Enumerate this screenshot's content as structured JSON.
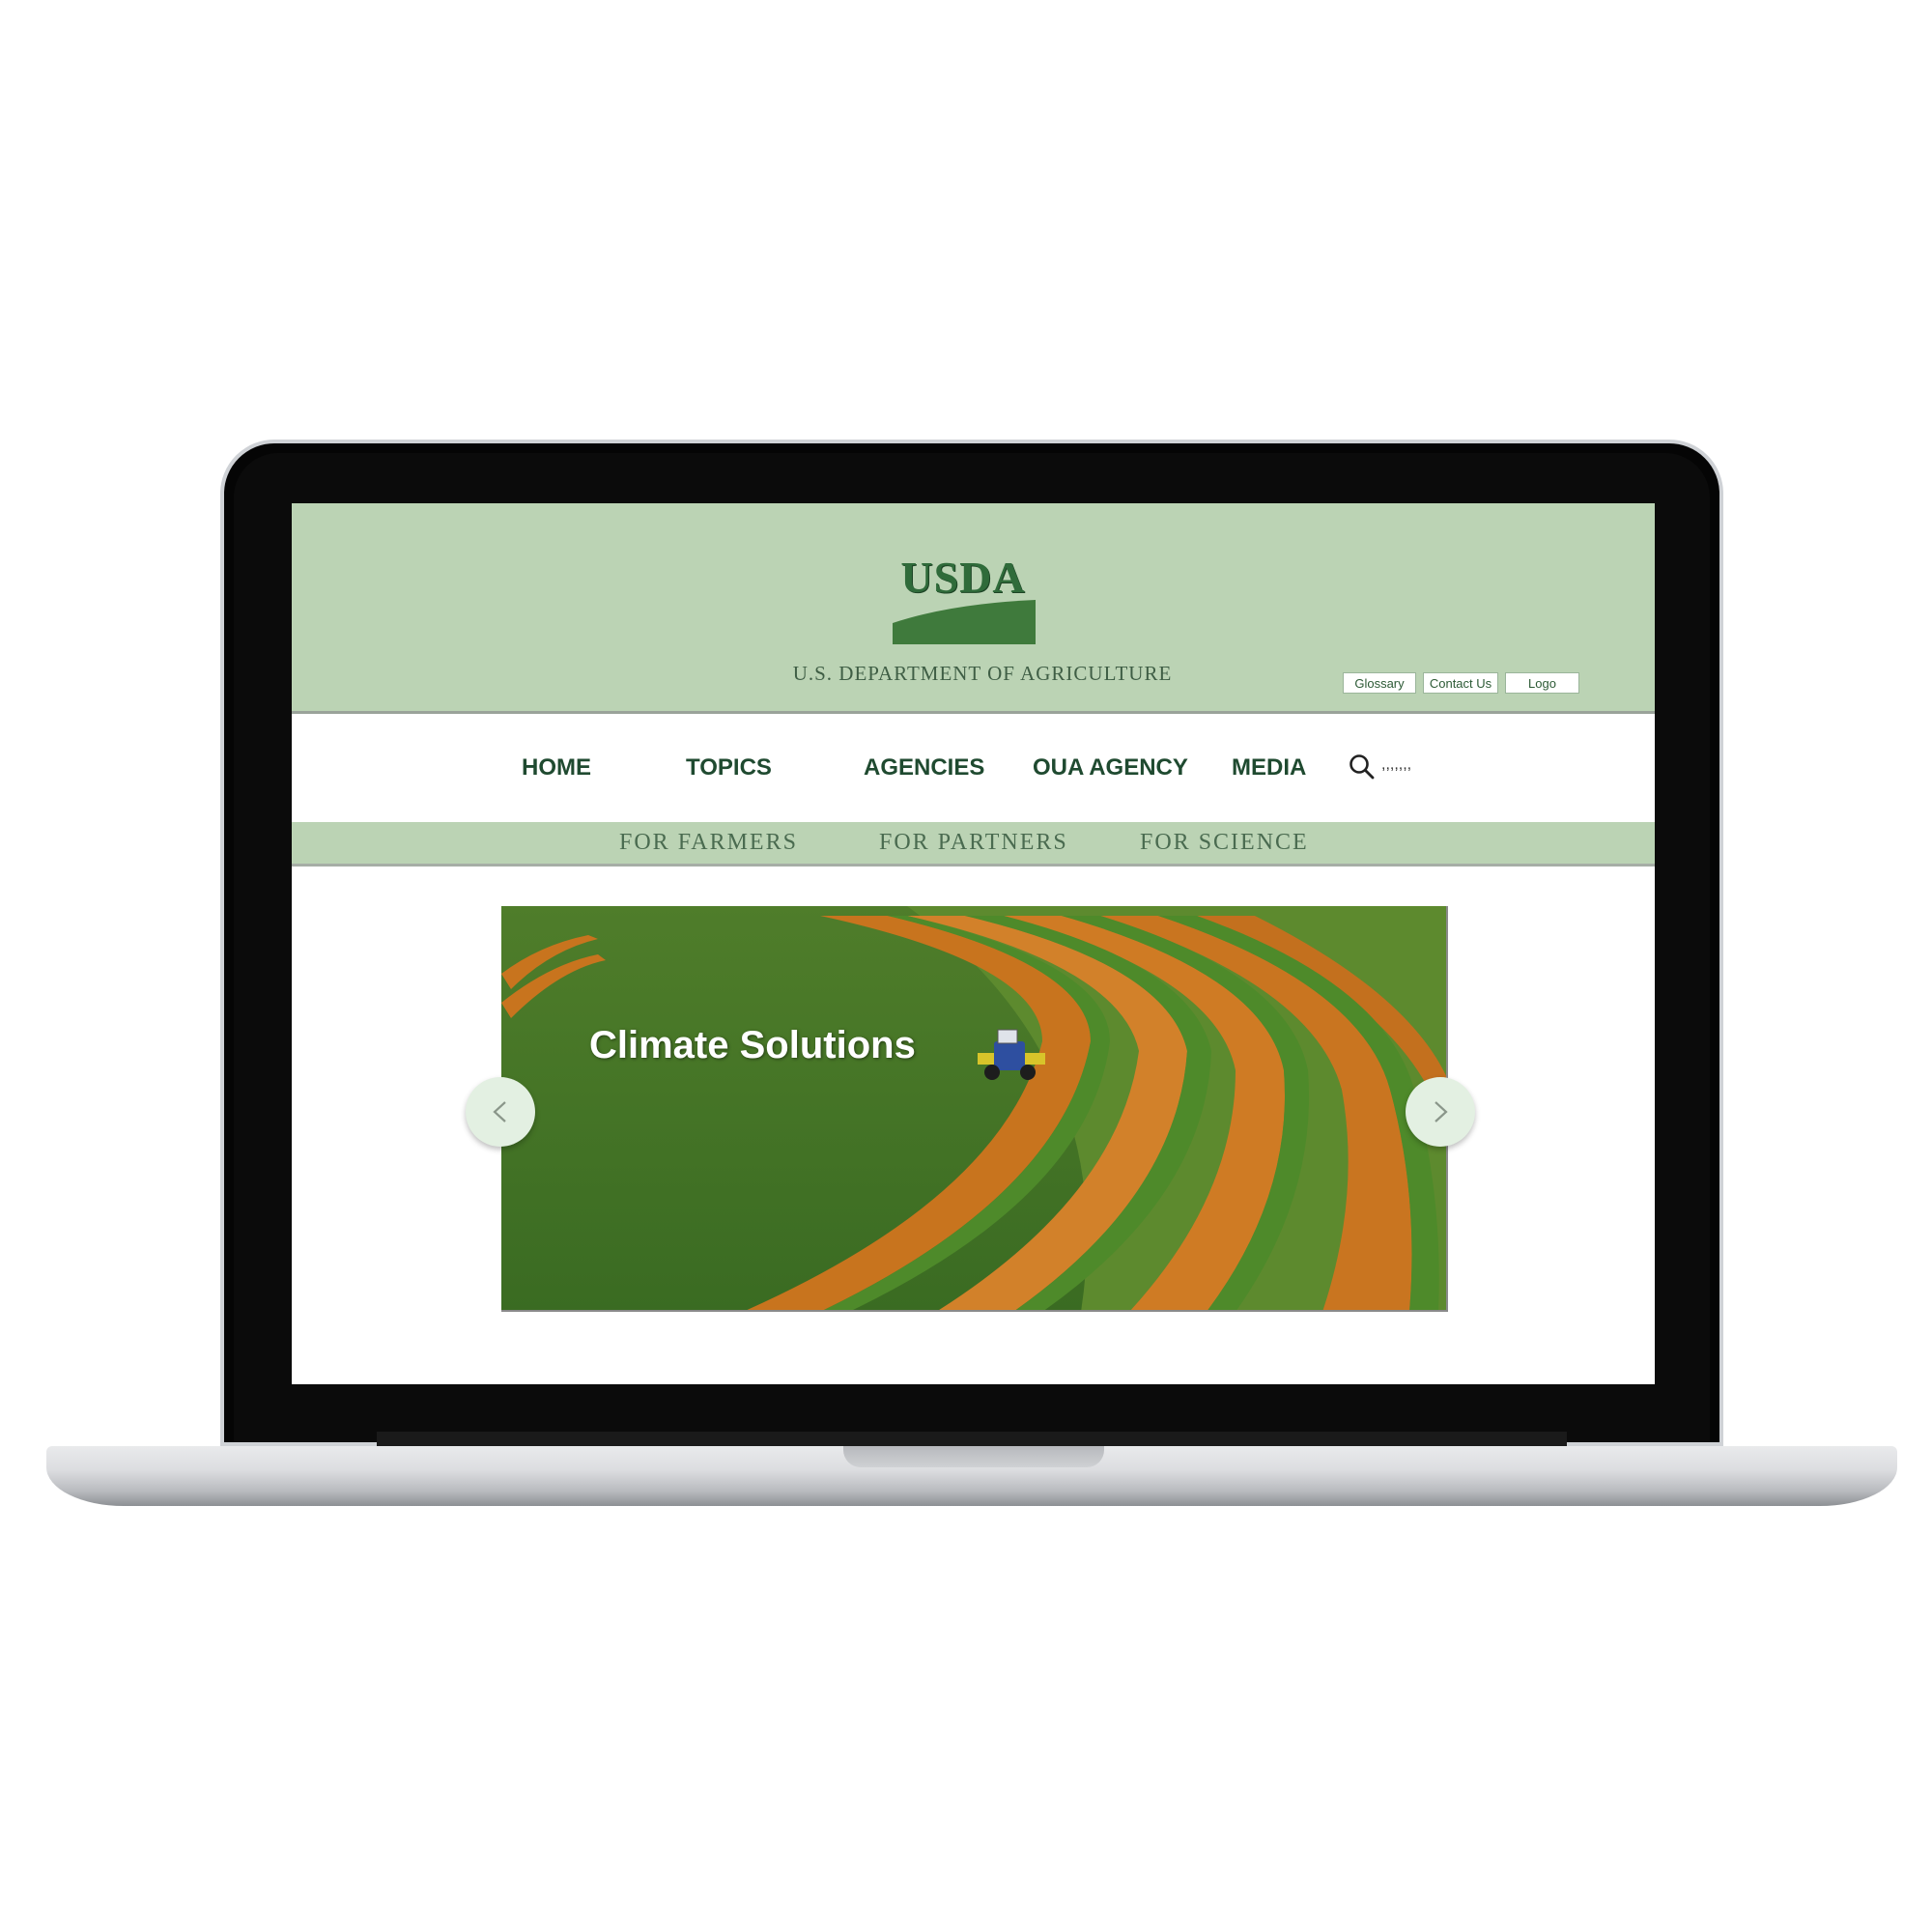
{
  "header": {
    "logo_text": "USDA",
    "department": "U.S. DEPARTMENT OF AGRICULTURE",
    "utility_links": [
      "Glossary",
      "Contact Us",
      "Logo"
    ]
  },
  "nav": {
    "items": [
      "HOME",
      "TOPICS",
      "AGENCIES",
      "OUA AGENCY",
      "MEDIA"
    ],
    "search_value": ",,,,,,,",
    "search_icon": "search-icon"
  },
  "subnav": {
    "items": [
      "FOR FARMERS",
      "FOR PARTNERS",
      "FOR SCIENCE"
    ]
  },
  "hero": {
    "title": "Climate Solutions",
    "prev_icon": "chevron-left-icon",
    "next_icon": "chevron-right-icon"
  },
  "colors": {
    "header_bg": "#bbd3b4",
    "brand_green": "#2f6b3a",
    "nav_text": "#1f4a30"
  }
}
